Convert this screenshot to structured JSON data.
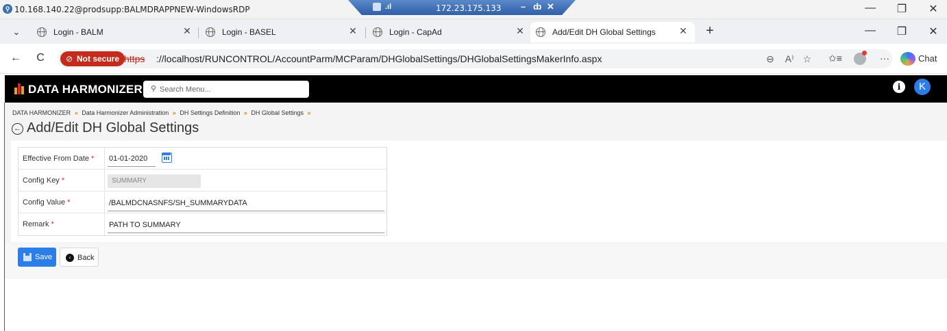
{
  "rdp": {
    "window_title": "10.168.140.22@prodsupp:BALMDRAPPNEW-WindowsRDP",
    "connection_ip": "172.23.175.133",
    "signal_glyph": ".ıl",
    "conn_minimize": "–",
    "conn_restore": "ȸ",
    "conn_close": "✕",
    "minimize": "—",
    "restore": "❐",
    "close": "✕"
  },
  "browser": {
    "tabs": [
      {
        "label": "Login - BALM",
        "close": "✕",
        "active": false
      },
      {
        "label": "Login - BASEL",
        "close": "✕",
        "active": false
      },
      {
        "label": "Login - CapAd",
        "close": "✕",
        "active": false
      },
      {
        "label": "Add/Edit DH Global Settings",
        "close": "✕",
        "active": true
      }
    ],
    "tab_list_glyph": "⌄",
    "new_tab_glyph": "+",
    "minimize": "—",
    "restore": "❐",
    "close": "✕",
    "back_glyph": "←",
    "refresh_glyph": "C",
    "security_label": "Not secure",
    "url_scheme": "https",
    "url_rest": "://localhost/RUNCONTROL/AccountParm/MCParam/DHGlobalSettings/DHGlobalSettingsMakerInfo.aspx",
    "zoom_glyph": "⊖",
    "read_aloud_glyph": "A⁾",
    "favorite_glyph": "☆",
    "favorites_glyph": "✩≡",
    "more_glyph": "···",
    "chat_label": "Chat"
  },
  "app": {
    "name": "DATA HARMONIZER",
    "search_placeholder": "Search Menu...",
    "search_glyph": "🔍︎",
    "info_glyph": "i",
    "user_initial": "K",
    "logo_colors": [
      "#e8a317",
      "#d9232e",
      "#e8a317"
    ]
  },
  "breadcrumb": {
    "items": [
      "DATA HARMONIZER",
      "Data Harmonizer Administration",
      "DH Settings Definition",
      "DH Global Settings"
    ],
    "separator": "»"
  },
  "page": {
    "back_glyph": "←",
    "title": "Add/Edit DH Global Settings"
  },
  "form": {
    "required_mark": "*",
    "effective_from_date": {
      "label": "Effective From Date",
      "value": "01-01-2020"
    },
    "config_key": {
      "label": "Config Key",
      "value": "SUMMARY"
    },
    "config_value": {
      "label": "Config Value",
      "value": "/BALMDCNASNFS/SH_SUMMARYDATA"
    },
    "remark": {
      "label": "Remark",
      "value": "PATH TO SUMMARY"
    }
  },
  "actions": {
    "save_label": "Save",
    "back_label": "Back",
    "back_glyph": "‹"
  },
  "colors": {
    "accent": "#2d7de6",
    "required": "#d9232e",
    "not_secure": "#c42b1c",
    "header_bg": "#000000"
  }
}
